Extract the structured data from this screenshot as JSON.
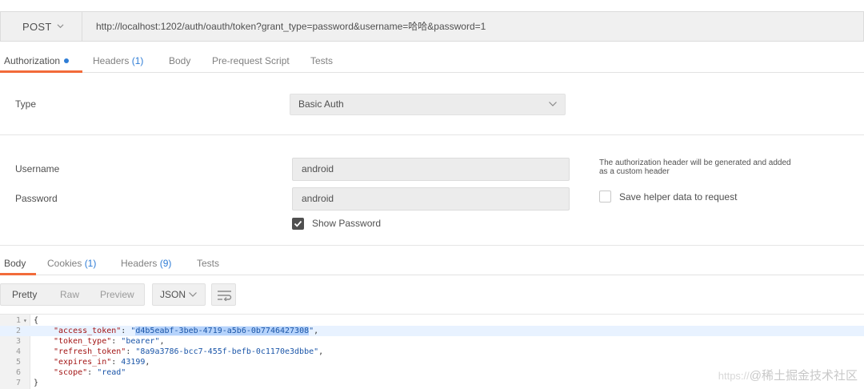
{
  "request": {
    "method": "POST",
    "url": "http://localhost:1202/auth/oauth/token?grant_type=password&username=哈哈&password=1"
  },
  "request_tabs": [
    {
      "label": "Authorization",
      "count": ""
    },
    {
      "label": "Headers ",
      "count": "(1)"
    },
    {
      "label": "Body",
      "count": ""
    },
    {
      "label": "Pre-request Script",
      "count": ""
    },
    {
      "label": "Tests",
      "count": ""
    }
  ],
  "auth": {
    "type_label": "Type",
    "type_value": "Basic Auth",
    "username_label": "Username",
    "username_value": "android",
    "password_label": "Password",
    "password_value": "android",
    "show_password_label": "Show Password",
    "show_password_checked": true,
    "info_text": "The authorization header will be generated and added as a custom header",
    "save_helper_label": "Save helper data to request",
    "save_helper_checked": false
  },
  "response_tabs": [
    {
      "label": "Body",
      "count": ""
    },
    {
      "label": "Cookies ",
      "count": "(1)"
    },
    {
      "label": "Headers ",
      "count": "(9)"
    },
    {
      "label": "Tests",
      "count": ""
    }
  ],
  "view_modes": [
    "Pretty",
    "Raw",
    "Preview"
  ],
  "format": "JSON",
  "response_body": {
    "lines": [
      "1",
      "2",
      "3",
      "4",
      "5",
      "6",
      "7"
    ],
    "open_brace": "{",
    "close_brace": "}",
    "access_token_key": "\"access_token\"",
    "access_token_value": "d4b5eabf-3beb-4719-a5b6-0b7746427308",
    "token_type_key": "\"token_type\"",
    "token_type_value": "\"bearer\"",
    "refresh_token_key": "\"refresh_token\"",
    "refresh_token_value": "\"8a9a3786-bcc7-455f-befb-0c1170e3dbbe\"",
    "expires_in_key": "\"expires_in\"",
    "expires_in_value": "43199",
    "scope_key": "\"scope\"",
    "scope_value": "\"read\""
  },
  "watermark": {
    "url_part": "https://",
    "text": "@稀土掘金技术社区"
  },
  "colors": {
    "accent": "#f26b3a",
    "count_blue": "#2f7dd6"
  }
}
